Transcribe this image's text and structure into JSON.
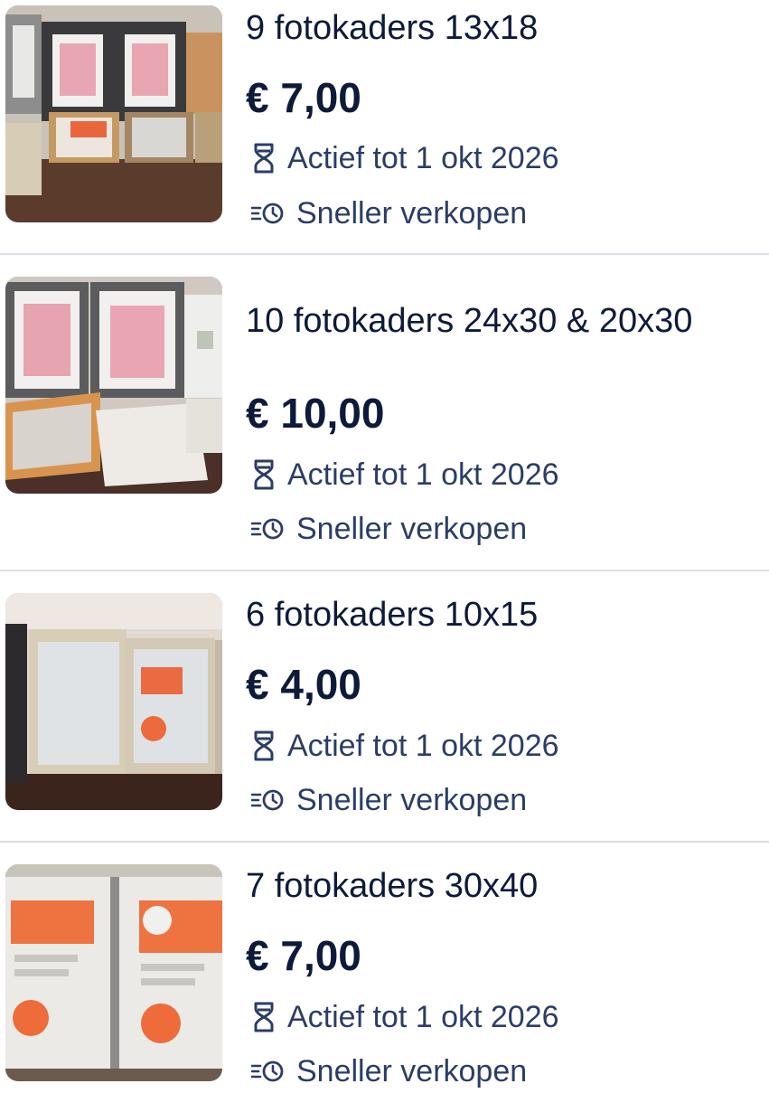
{
  "listings": [
    {
      "title": "9 fotokaders 13x18",
      "price": "€ 7,00",
      "status": "Actief tot 1 okt 2026",
      "action": "Sneller verkopen",
      "thumbnail_icon": "photo-frames-image"
    },
    {
      "title": "10 fotokaders 24x30 & 20x30",
      "price": "€ 10,00",
      "status": "Actief tot 1 okt 2026",
      "action": "Sneller verkopen",
      "thumbnail_icon": "photo-frames-image"
    },
    {
      "title": "6 fotokaders 10x15",
      "price": "€ 4,00",
      "status": "Actief tot 1 okt 2026",
      "action": "Sneller verkopen",
      "thumbnail_icon": "photo-frames-image"
    },
    {
      "title": "7 fotokaders 30x40",
      "price": "€ 7,00",
      "status": "Actief tot 1 okt 2026",
      "action": "Sneller verkopen",
      "thumbnail_icon": "photo-frames-image"
    }
  ],
  "icons": {
    "status": "hourglass-icon",
    "action": "speed-clock-icon"
  },
  "colors": {
    "text": "#0d1a3a",
    "meta_text": "#2b3d66",
    "divider": "#dcdfe5"
  }
}
